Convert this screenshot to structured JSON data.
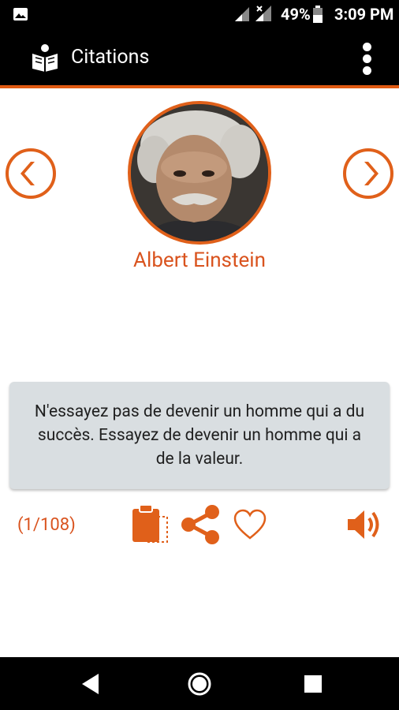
{
  "status_bar": {
    "battery_percent": "49%",
    "time": "3:09 PM",
    "icons": [
      "gallery-icon",
      "signal-icon",
      "signal-x-icon",
      "battery-icon"
    ]
  },
  "app_bar": {
    "title": "Citations",
    "logo_icon": "reading-person-icon",
    "menu_icon": "overflow-menu-icon"
  },
  "author": {
    "name": "Albert Einstein",
    "portrait": "author-portrait"
  },
  "navigation": {
    "prev_icon": "chevron-left-icon",
    "next_icon": "chevron-right-icon"
  },
  "quote": {
    "text": "N'essayez pas de devenir un homme qui a du succès. Essayez de devenir un homme qui a de la valeur."
  },
  "actions": {
    "counter": "(1/108)",
    "icons": [
      "clipboard-copy-icon",
      "share-icon",
      "heart-icon",
      "speaker-icon"
    ]
  },
  "system_nav": {
    "icons": [
      "back-icon",
      "home-icon",
      "recents-icon"
    ]
  },
  "colors": {
    "accent": "#e0601a",
    "author_text": "#d9531e",
    "card_bg": "#d9dee1",
    "bars": "#000000"
  }
}
